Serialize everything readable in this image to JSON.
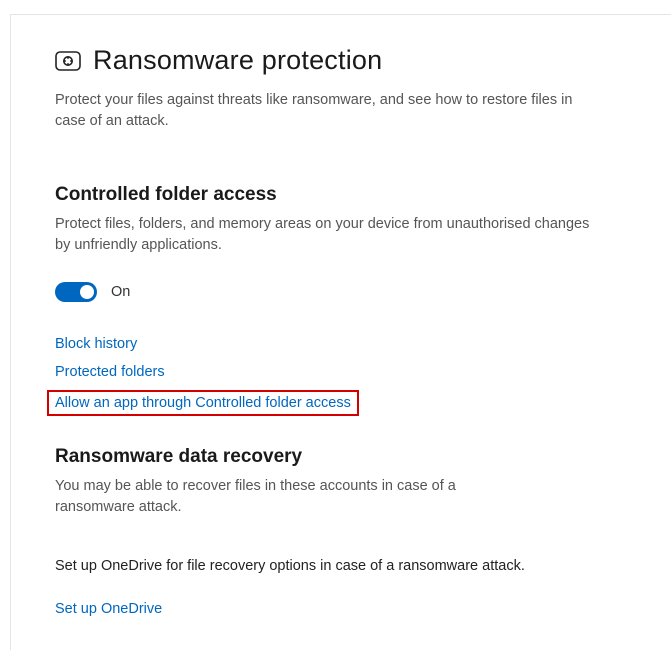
{
  "header": {
    "title": "Ransomware protection",
    "description": "Protect your files against threats like ransomware, and see how to restore files in case of an attack."
  },
  "cfa": {
    "title": "Controlled folder access",
    "description": "Protect files, folders, and memory areas on your device from unauthorised changes by unfriendly applications.",
    "toggle_state": "On",
    "toggle_on": true,
    "links": {
      "block_history": "Block history",
      "protected_folders": "Protected folders",
      "allow_app": "Allow an app through Controlled folder access"
    }
  },
  "recovery": {
    "title": "Ransomware data recovery",
    "description": "You may be able to recover files in these accounts in case of a ransomware attack.",
    "onedrive_prompt": "Set up OneDrive for file recovery options in case of a ransomware attack.",
    "onedrive_link": "Set up OneDrive"
  }
}
